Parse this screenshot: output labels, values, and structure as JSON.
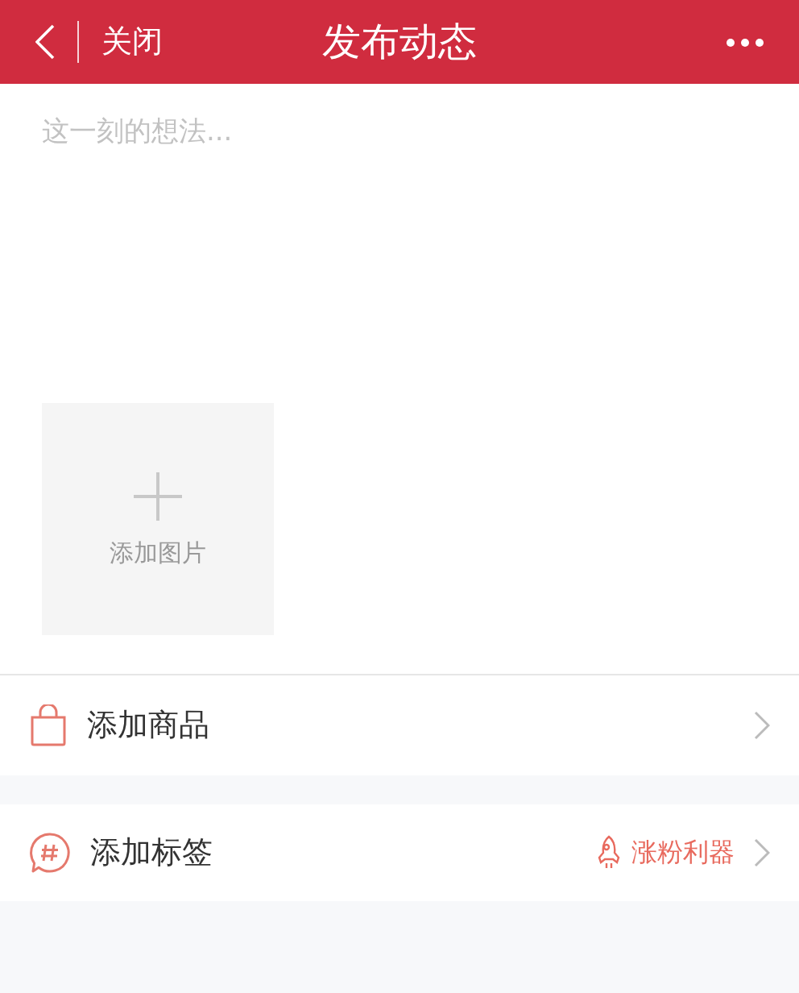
{
  "header": {
    "back_label": "关闭",
    "title": "发布动态"
  },
  "post": {
    "placeholder": "这一刻的想法..."
  },
  "add_image": {
    "label": "添加图片"
  },
  "options": [
    {
      "kind": "product",
      "label": "添加商品"
    },
    {
      "kind": "tag",
      "label": "添加标签",
      "hint": "涨粉利器"
    }
  ]
}
